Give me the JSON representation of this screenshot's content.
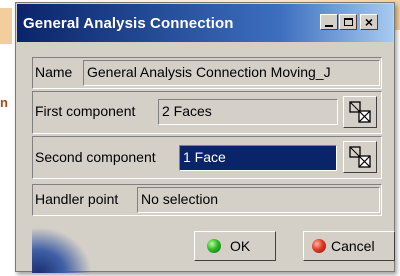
{
  "background": {
    "side_text": "n"
  },
  "window": {
    "title": "General Analysis Connection",
    "controls": {
      "minimize_icon": "minimize-icon",
      "maximize_icon": "maximize-icon",
      "close_glyph": "×"
    }
  },
  "form": {
    "name": {
      "label": "Name",
      "value": "General Analysis Connection Moving_J"
    },
    "first_component": {
      "label": "First component",
      "value": "2 Faces",
      "picker_icon": "geometry-selection-icon"
    },
    "second_component": {
      "label": "Second component",
      "value": "1 Face",
      "picker_icon": "geometry-selection-icon"
    },
    "handler_point": {
      "label": "Handler point",
      "value": "No selection"
    }
  },
  "buttons": {
    "ok_label": "OK",
    "cancel_label": "Cancel"
  },
  "colors": {
    "title_bar": "#0a246a",
    "dialog_bg": "#d4d0c8",
    "selected_field": "#0a246a",
    "ok_dot": "#2fb82a",
    "cancel_dot": "#e03b23"
  }
}
